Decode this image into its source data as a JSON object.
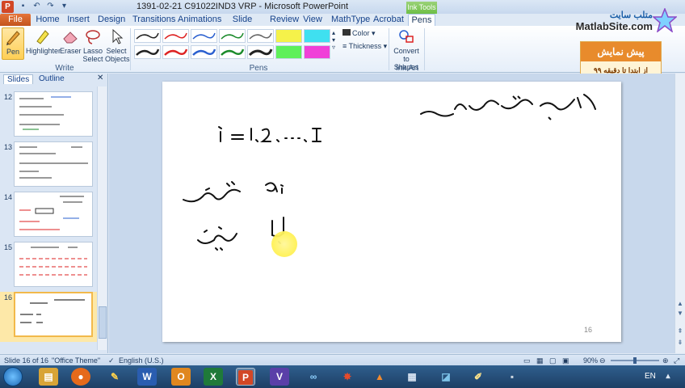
{
  "window": {
    "title": "1391-02-21 C91022IND3 VRP  -  Microsoft PowerPoint",
    "app_icon": "P"
  },
  "ribbon_tabs": {
    "file": "File",
    "home": "Home",
    "insert": "Insert",
    "design": "Design",
    "transitions": "Transitions",
    "animations": "Animations",
    "slideshow": "Slide Show",
    "review": "Review",
    "view": "View",
    "mathtype": "MathType",
    "acrobat": "Acrobat",
    "pens": "Pens",
    "ink_tools": "Ink Tools"
  },
  "ribbon": {
    "pen": "Pen",
    "highlighter": "Highlighter",
    "eraser": "Eraser",
    "lasso_select": "Lasso Select",
    "select_objects": "Select Objects",
    "write_group": "Write",
    "pens_group": "Pens",
    "color": "Color",
    "thickness": "Thickness",
    "convert_to_shapes": "Convert to Shapes",
    "ink_art_group": "Ink Art"
  },
  "brand": {
    "tagline": "متلب سایت",
    "url": "MatlabSite.com"
  },
  "banner": {
    "title": "پیش نمایش",
    "subtitle": "از ابتدا تا دقیقه ۹۹"
  },
  "pane": {
    "tab_slides": "Slides",
    "tab_outline": "Outline",
    "thumbnails": [
      {
        "num": "12"
      },
      {
        "num": "13"
      },
      {
        "num": "14"
      },
      {
        "num": "15"
      },
      {
        "num": "16",
        "selected": true
      }
    ]
  },
  "slide": {
    "number": "16"
  },
  "status": {
    "slide_of": "Slide 16 of 16",
    "theme": "\"Office Theme\"",
    "language": "English (U.S.)",
    "zoom": "90%"
  },
  "taskbar": {
    "language": "EN"
  },
  "colors": {
    "ribbon_accent": "#e5743a",
    "ink_tools": "#6dbf45",
    "banner_orange": "#e88b2c",
    "highlight": "#fff25a"
  }
}
